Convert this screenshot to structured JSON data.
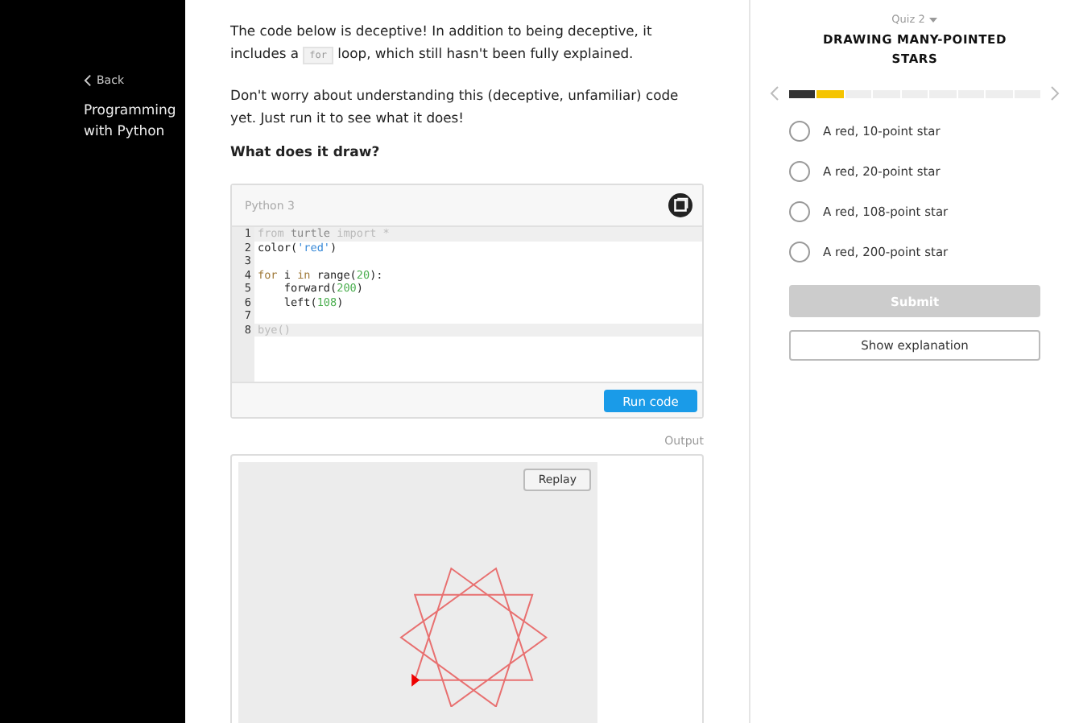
{
  "sidebar": {
    "back": "Back",
    "course": "Programming with Python"
  },
  "intro": [
    {
      "text": "The code below is deceptive! In addition to being deceptive, it includes a "
    },
    {
      "text": "for",
      "kind": "code"
    },
    {
      "text": " loop, which still hasn't been fully explained."
    }
  ],
  "paragraph": "Don't worry about understanding this (deceptive, unfamiliar) code yet. Just run it to see what it does!",
  "question": "What does it draw?",
  "editor": {
    "language": "Python 3",
    "run_button": "Run code",
    "lines": [
      {
        "number": "1",
        "highlighted": true,
        "tokens": [
          {
            "text": "from",
            "kind": "dim"
          },
          {
            "text": " turtle ",
            "kind": "plain-dim"
          },
          {
            "text": "import *",
            "kind": "dim"
          }
        ]
      },
      {
        "number": "2",
        "highlighted": false,
        "tokens": [
          {
            "text": "color(",
            "kind": "plain"
          },
          {
            "text": "'red'",
            "kind": "string"
          },
          {
            "text": ")",
            "kind": "plain"
          }
        ]
      },
      {
        "number": "3",
        "highlighted": false
      },
      {
        "number": "4",
        "highlighted": false,
        "tokens": [
          {
            "text": "for",
            "kind": "keyword"
          },
          {
            "text": " i ",
            "kind": "plain"
          },
          {
            "text": "in",
            "kind": "keyword"
          },
          {
            "text": " range(",
            "kind": "plain"
          },
          {
            "text": "20",
            "kind": "number"
          },
          {
            "text": "):",
            "kind": "plain"
          }
        ]
      },
      {
        "number": "5",
        "highlighted": false,
        "tokens": [
          {
            "text": "    forward(",
            "kind": "plain"
          },
          {
            "text": "200",
            "kind": "number"
          },
          {
            "text": ")",
            "kind": "plain"
          }
        ]
      },
      {
        "number": "6",
        "highlighted": false,
        "tokens": [
          {
            "text": "    left(",
            "kind": "plain"
          },
          {
            "text": "108",
            "kind": "number"
          },
          {
            "text": ")",
            "kind": "plain"
          }
        ]
      },
      {
        "number": "7",
        "highlighted": false
      },
      {
        "number": "8",
        "highlighted": true,
        "tokens": [
          {
            "text": "bye()",
            "kind": "dim"
          }
        ]
      }
    ]
  },
  "output": {
    "label": "Output",
    "replay_button": "Replay"
  },
  "quiz": {
    "label": "Quiz 2",
    "title": "DRAWING MANY-POINTED STARS",
    "segments": [
      {
        "color": "#333333"
      },
      {
        "color": "#f5c400"
      },
      {
        "color": "#eeeeee"
      },
      {
        "color": "#eeeeee"
      },
      {
        "color": "#eeeeee"
      },
      {
        "color": "#eeeeee"
      },
      {
        "color": "#eeeeee"
      },
      {
        "color": "#eeeeee"
      },
      {
        "color": "#eeeeee"
      }
    ],
    "options": [
      {
        "label": "A red, 10-point star",
        "selected": false
      },
      {
        "label": "A red, 20-point star",
        "selected": false
      },
      {
        "label": "A red, 108-point star",
        "selected": false
      },
      {
        "label": "A red, 200-point star",
        "selected": false
      }
    ],
    "submit": {
      "label": "Submit",
      "disabled": true
    },
    "explain": "Show explanation"
  }
}
